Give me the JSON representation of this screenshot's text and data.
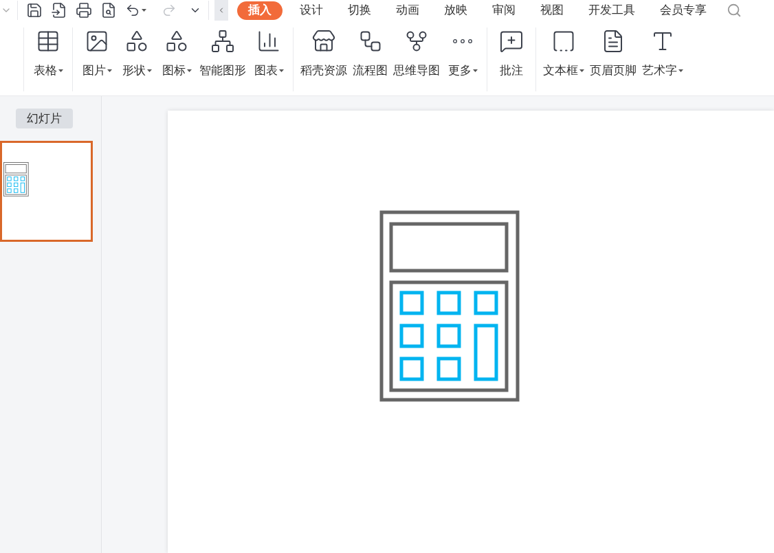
{
  "ribbon_tabs": [
    {
      "label": "插入",
      "selected": true
    },
    {
      "label": "设计",
      "selected": false
    },
    {
      "label": "切换",
      "selected": false
    },
    {
      "label": "动画",
      "selected": false
    },
    {
      "label": "放映",
      "selected": false
    },
    {
      "label": "审阅",
      "selected": false
    },
    {
      "label": "视图",
      "selected": false
    },
    {
      "label": "开发工具",
      "selected": false
    },
    {
      "label": "会员专享",
      "selected": false
    }
  ],
  "ribbon_groups": [
    [
      {
        "label": "表格",
        "dropdown": true
      }
    ],
    [
      {
        "label": "图片",
        "dropdown": true
      },
      {
        "label": "形状",
        "dropdown": true
      },
      {
        "label": "图标",
        "dropdown": true
      },
      {
        "label": "智能图形",
        "dropdown": false
      },
      {
        "label": "图表",
        "dropdown": true
      }
    ],
    [
      {
        "label": "稻壳资源",
        "dropdown": false
      },
      {
        "label": "流程图",
        "dropdown": false
      },
      {
        "label": "思维导图",
        "dropdown": false
      },
      {
        "label": "更多",
        "dropdown": true
      }
    ],
    [
      {
        "label": "批注",
        "dropdown": false
      }
    ],
    [
      {
        "label": "文本框",
        "dropdown": true
      },
      {
        "label": "页眉页脚",
        "dropdown": false
      },
      {
        "label": "艺术字",
        "dropdown": true
      }
    ]
  ],
  "panel_tabs": [
    {
      "label": "幻灯片",
      "selected": true
    }
  ],
  "slides": [
    {
      "selected": true
    }
  ]
}
